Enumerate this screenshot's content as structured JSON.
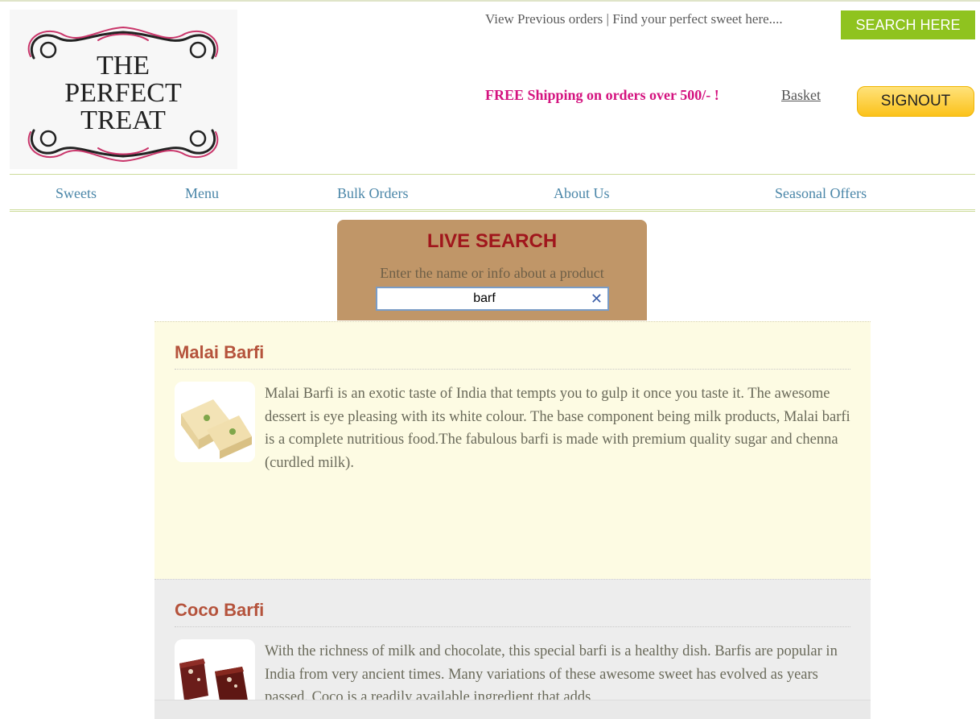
{
  "logo": {
    "line1": "THE",
    "line2": "PERFECT",
    "line3": "TREAT"
  },
  "header": {
    "view_orders": "View Previous orders",
    "separator": " | ",
    "find_sweet": "Find your perfect sweet here....",
    "search_here": "SEARCH HERE",
    "free_shipping": "FREE Shipping on orders over 500/- !",
    "basket": "Basket",
    "signout": "SIGNOUT"
  },
  "nav": {
    "items": [
      {
        "label": "Sweets"
      },
      {
        "label": "Menu"
      },
      {
        "label": "Bulk Orders"
      },
      {
        "label": "About Us"
      },
      {
        "label": "Seasonal Offers"
      }
    ]
  },
  "live_search": {
    "title": "LIVE SEARCH",
    "hint": "Enter the name or info about a product",
    "value": "barf",
    "clear_icon": "close-icon"
  },
  "results": [
    {
      "title": "Malai Barfi",
      "description": "Malai Barfi is an exotic taste of India that tempts you to gulp it once you taste it. The awesome dessert is eye pleasing with its white colour. The base component being milk products, Malai barfi is a complete nutritious food.The fabulous barfi is made with premium quality sugar and chenna (curdled milk)."
    },
    {
      "title": "Coco Barfi",
      "description": "With the richness of milk and chocolate, this special barfi is a healthy dish. Barfis are popular in India from very ancient times. Many variations of these awesome sweet has evolved as years passed. Coco is a readily available ingredient that adds"
    }
  ],
  "colors": {
    "accent_green": "#8fc31f",
    "signout_yellow": "#fbc21a",
    "shipping_pink": "#d4137f",
    "nav_blue": "#4a86a8",
    "live_search_bg": "#c09668",
    "live_search_title": "#a0161c",
    "result_title": "#b5533c"
  }
}
